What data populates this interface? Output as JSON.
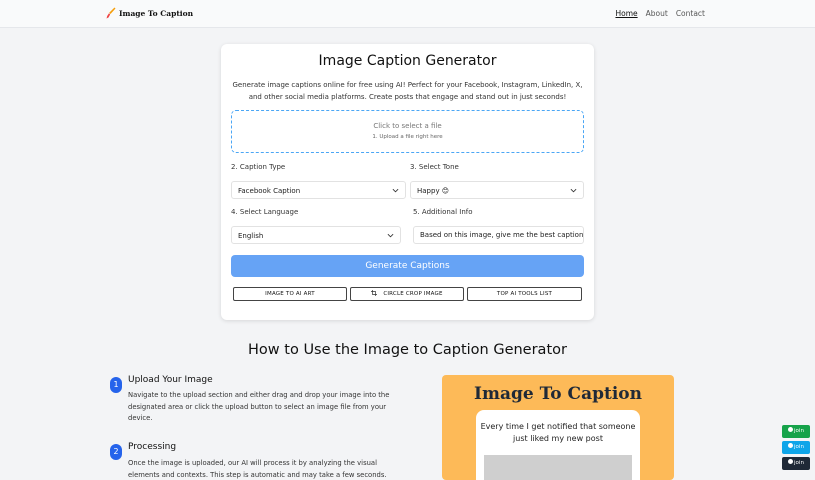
{
  "nav": {
    "logo_text": "Image To Caption",
    "links": [
      "Home",
      "About",
      "Contact"
    ]
  },
  "card": {
    "title": "Image Caption Generator",
    "description": "Generate image captions online for free using AI! Perfect for your Facebook, Instagram, LinkedIn, X, and other social media platforms. Create posts that engage and stand out in just seconds!",
    "dropzone": {
      "title": "Click to select a file",
      "subtitle": "1. Upload a file right here"
    },
    "caption_type": {
      "label": "2. Caption Type",
      "value": "Facebook Caption"
    },
    "tone": {
      "label": "3. Select Tone",
      "value": "Happy 😊"
    },
    "language": {
      "label": "4. Select Language",
      "value": "English"
    },
    "additional_info": {
      "label": "5. Additional Info",
      "value": "Based on this image, give me the best caption"
    },
    "generate_label": "Generate Captions",
    "tools": [
      "IMAGE TO AI ART",
      "CIRCLE CROP IMAGE",
      "TOP AI TOOLS LIST"
    ]
  },
  "howto": {
    "title": "How to Use the Image to Caption Generator",
    "steps": [
      {
        "num": "1",
        "title": "Upload Your Image",
        "desc": "Navigate to the upload section and either drag and drop your image into the designated area or click the upload button to select an image file from your device."
      },
      {
        "num": "2",
        "title": "Processing",
        "desc": "Once the image is uploaded, our AI will process it by analyzing the visual elements and contexts. This step is automatic and may take a few seconds."
      }
    ]
  },
  "preview": {
    "title": "Image To Caption",
    "caption": "Every time I get notified that someone just liked my new post"
  },
  "join": {
    "label": "join",
    "buttons": [
      {
        "icon": "whatsapp-icon",
        "color": "#16a34a"
      },
      {
        "icon": "telegram-icon",
        "color": "#0ea5e9"
      },
      {
        "icon": "facebook-icon",
        "color": "#1f2937"
      }
    ]
  },
  "colors": {
    "accent": "#66a3f5",
    "step_badge": "#2563eb",
    "dropzone_border": "#4aa6f5",
    "preview_bg": "#fdba58"
  }
}
